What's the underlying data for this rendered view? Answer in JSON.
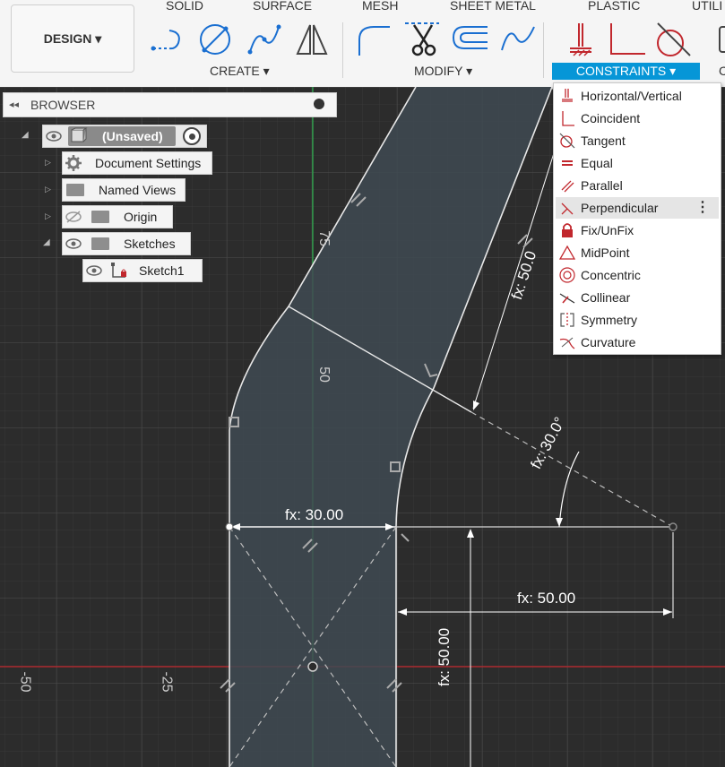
{
  "toolbar": {
    "tabs": [
      "SOLID",
      "SURFACE",
      "MESH",
      "SHEET METAL",
      "PLASTIC",
      "UTILI"
    ],
    "design_label": "DESIGN ▾",
    "groups": {
      "create": "CREATE ▾",
      "modify": "MODIFY ▾",
      "constraints": "CONSTRAINTS ▾",
      "next_partial": "C"
    }
  },
  "browser": {
    "title": "BROWSER",
    "root": "(Unsaved)",
    "items": [
      "Document Settings",
      "Named Views",
      "Origin",
      "Sketches",
      "Sketch1"
    ]
  },
  "constraints_menu": {
    "items": [
      {
        "label": "Horizontal/Vertical",
        "icon": "horizontal-vertical-icon"
      },
      {
        "label": "Coincident",
        "icon": "coincident-icon"
      },
      {
        "label": "Tangent",
        "icon": "tangent-icon"
      },
      {
        "label": "Equal",
        "icon": "equal-icon"
      },
      {
        "label": "Parallel",
        "icon": "parallel-icon"
      },
      {
        "label": "Perpendicular",
        "icon": "perpendicular-icon"
      },
      {
        "label": "Fix/UnFix",
        "icon": "lock-icon"
      },
      {
        "label": "MidPoint",
        "icon": "midpoint-icon"
      },
      {
        "label": "Concentric",
        "icon": "concentric-icon"
      },
      {
        "label": "Collinear",
        "icon": "collinear-icon"
      },
      {
        "label": "Symmetry",
        "icon": "symmetry-icon"
      },
      {
        "label": "Curvature",
        "icon": "curvature-icon"
      }
    ],
    "highlighted": "Perpendicular"
  },
  "sketch": {
    "dimensions": {
      "width_label": "fx: 30.00",
      "horiz_label": "fx: 50.00",
      "vert_label": "fx: 50.00",
      "diag_label": "fx: 50.0",
      "angle_label": "fx: 30.0°"
    },
    "ruler_labels": [
      "75",
      "50",
      "-50",
      "-25"
    ]
  },
  "colors": {
    "accent": "#0696d7",
    "axis_x": "#c1272d",
    "axis_y": "#2bb24c",
    "sketch_fill": "#3f4a52",
    "grid": "#3a3a3a"
  }
}
